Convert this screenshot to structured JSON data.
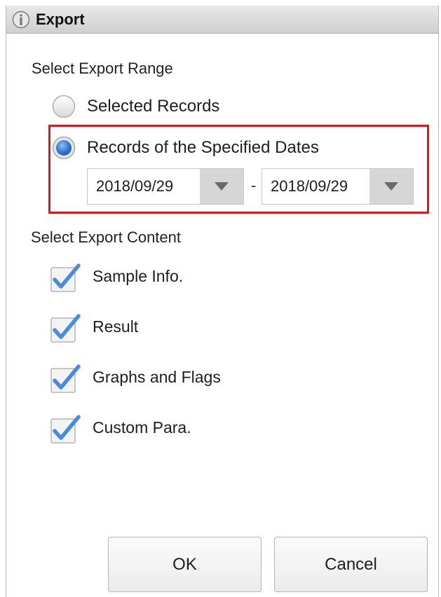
{
  "dialog": {
    "title": "Export",
    "title_icon": "info-icon"
  },
  "range_section": {
    "label": "Select Export Range",
    "options": [
      {
        "label": "Selected Records",
        "selected": false
      },
      {
        "label": "Records of the Specified Dates",
        "selected": true
      }
    ],
    "start_date": "2018/09/29",
    "end_date": "2018/09/29",
    "separator": "-",
    "highlight_color": "#d71920"
  },
  "content_section": {
    "label": "Select Export Content",
    "items": [
      {
        "label": "Sample Info.",
        "checked": true
      },
      {
        "label": "Result",
        "checked": true
      },
      {
        "label": "Graphs and Flags",
        "checked": true
      },
      {
        "label": "Custom Para.",
        "checked": true
      }
    ]
  },
  "buttons": {
    "ok": "OK",
    "cancel": "Cancel"
  },
  "colors": {
    "accent_blue": "#3d7fd6",
    "check_blue": "#4a8be0"
  }
}
